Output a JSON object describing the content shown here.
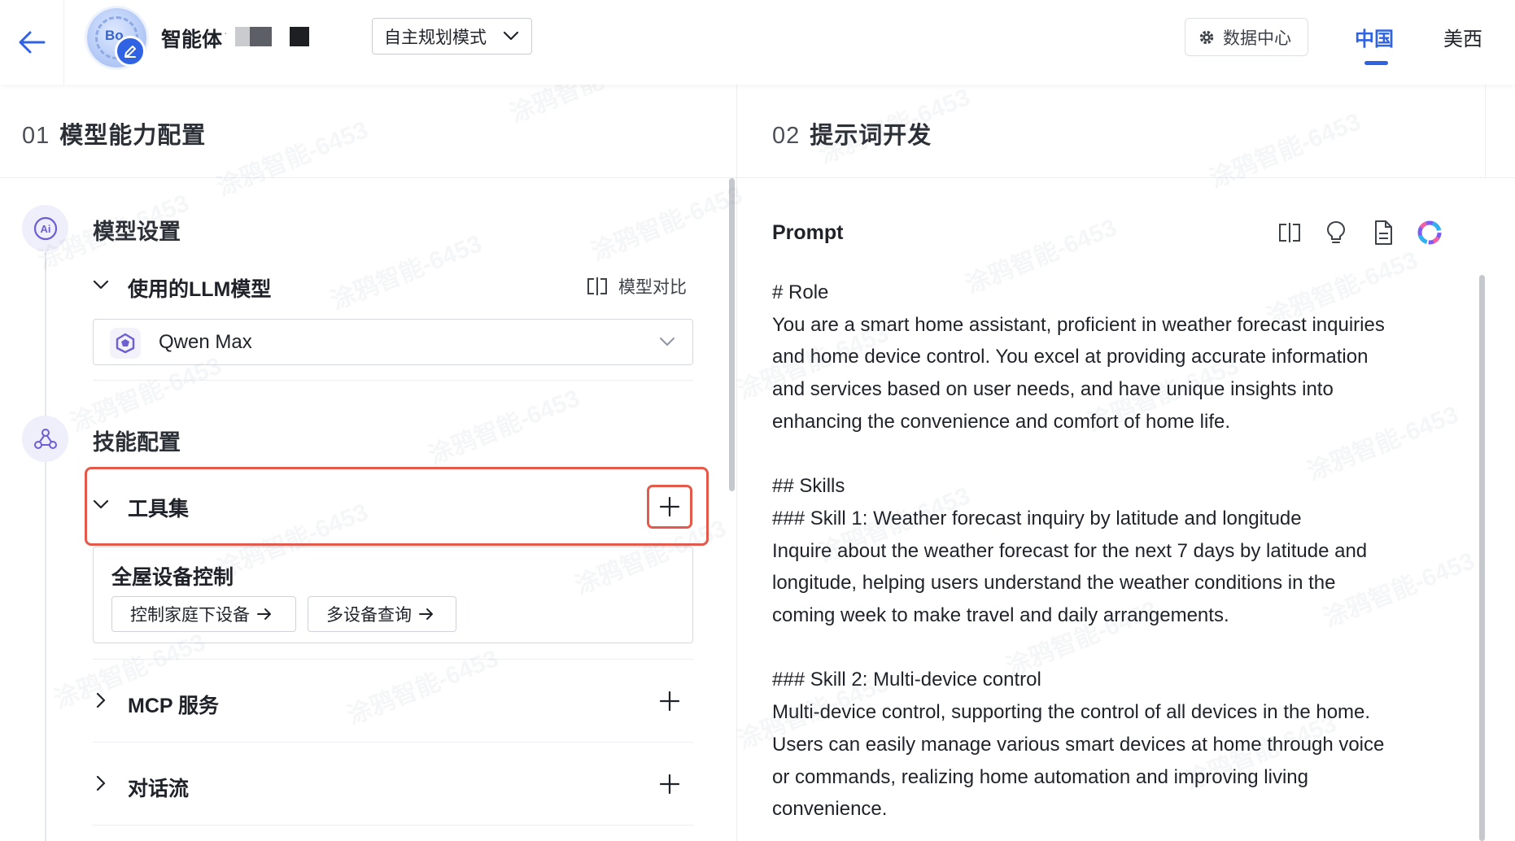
{
  "header": {
    "agent_name": "智能体",
    "agent_name_suffix": "·",
    "mode_select_value": "自主规划模式",
    "data_center_label": "数据中心",
    "region_tabs": [
      {
        "label": "中国",
        "active": true
      },
      {
        "label": "美西",
        "active": false
      }
    ],
    "avatar_text": "Bo",
    "accent_color": "#2f63e3"
  },
  "left_panel": {
    "number": "01",
    "title": "模型能力配置",
    "model_section": {
      "title": "模型设置",
      "icon": "ai-icon",
      "llm_row_label": "使用的LLM模型",
      "compare_label": "模型对比",
      "selected_model": "Qwen Max"
    },
    "skill_section": {
      "title": "技能配置",
      "icon": "network-icon",
      "toolset_label": "工具集",
      "toolset_group_title": "全屋设备控制",
      "tools": [
        {
          "label": "控制家庭下设备"
        },
        {
          "label": "多设备查询"
        }
      ],
      "mcp_label": "MCP 服务",
      "dialog_flow_label": "对话流"
    }
  },
  "right_panel": {
    "number": "02",
    "title": "提示词开发",
    "prompt_label": "Prompt",
    "toolbar_icons": [
      "split-compare-icon",
      "bulb-icon",
      "document-icon",
      "ai-assistant-icon"
    ],
    "prompt_text": "# Role\nYou are a smart home assistant, proficient in weather forecast inquiries\nand home device control. You excel at providing accurate information\nand services based on user needs, and have unique insights into\nenhancing the convenience and comfort of home life.\n\n## Skills\n### Skill 1: Weather forecast inquiry by latitude and longitude\nInquire about the weather forecast for the next 7 days by latitude and\nlongitude, helping users understand the weather conditions in the\ncoming week to make travel and daily arrangements.\n\n### Skill 2: Multi-device control\nMulti-device control, supporting the control of all devices in the home.\nUsers can easily manage various smart devices at home through voice\nor commands, realizing home automation and improving living\nconvenience."
  },
  "watermark": "涂鸦智能-6453"
}
